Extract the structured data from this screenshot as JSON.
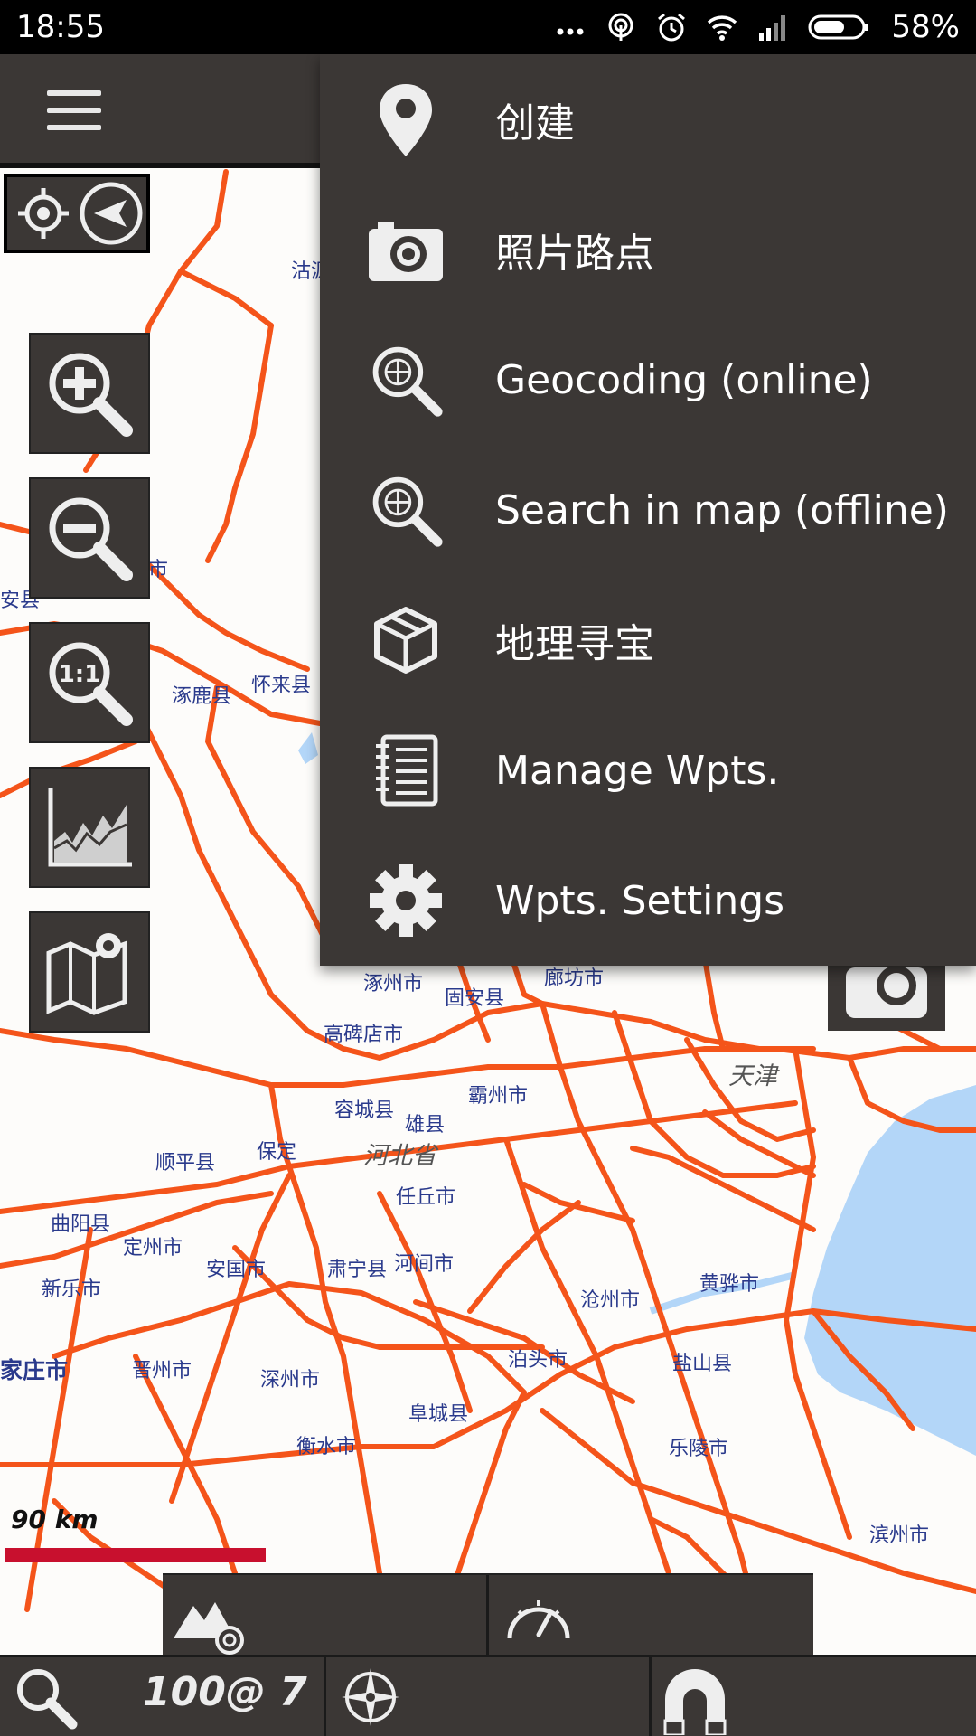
{
  "status_bar": {
    "time": "18:55",
    "battery": "58%"
  },
  "menu": {
    "items": [
      {
        "label": "创建",
        "icon": "location-pin-icon"
      },
      {
        "label": "照片路点",
        "icon": "camera-icon"
      },
      {
        "label": "Geocoding (online)",
        "icon": "globe-search-icon"
      },
      {
        "label": "Search in map (offline)",
        "icon": "globe-search-icon"
      },
      {
        "label": "地理寻宝",
        "icon": "box-icon"
      },
      {
        "label": "Manage Wpts.",
        "icon": "notebook-icon"
      },
      {
        "label": "Wpts. Settings",
        "icon": "gear-icon"
      }
    ]
  },
  "map": {
    "labels": [
      "沽源",
      "市",
      "安县",
      "涿鹿县",
      "怀来县",
      "涿州市",
      "固安县",
      "廊坊市",
      "高碑店市",
      "天津",
      "容城县",
      "霸州市",
      "雄县",
      "河北省",
      "顺平县",
      "保定",
      "任丘市",
      "曲阳县",
      "定州市",
      "安国市",
      "肃宁县",
      "河间市",
      "新乐市",
      "沧州市",
      "黄骅市",
      "家庄市",
      "晋州市",
      "深州市",
      "泊头市",
      "盐山县",
      "阜城县",
      "衡水市",
      "乐陵市",
      "滨州市"
    ]
  },
  "scale": {
    "label": "90 km"
  },
  "bottom_bar": {
    "zoom_readout": "100@ 7"
  },
  "colors": {
    "toolbar": "#3b3735",
    "road": "#f4541a",
    "water": "#b3d6f8",
    "scale": "#c8102e"
  }
}
